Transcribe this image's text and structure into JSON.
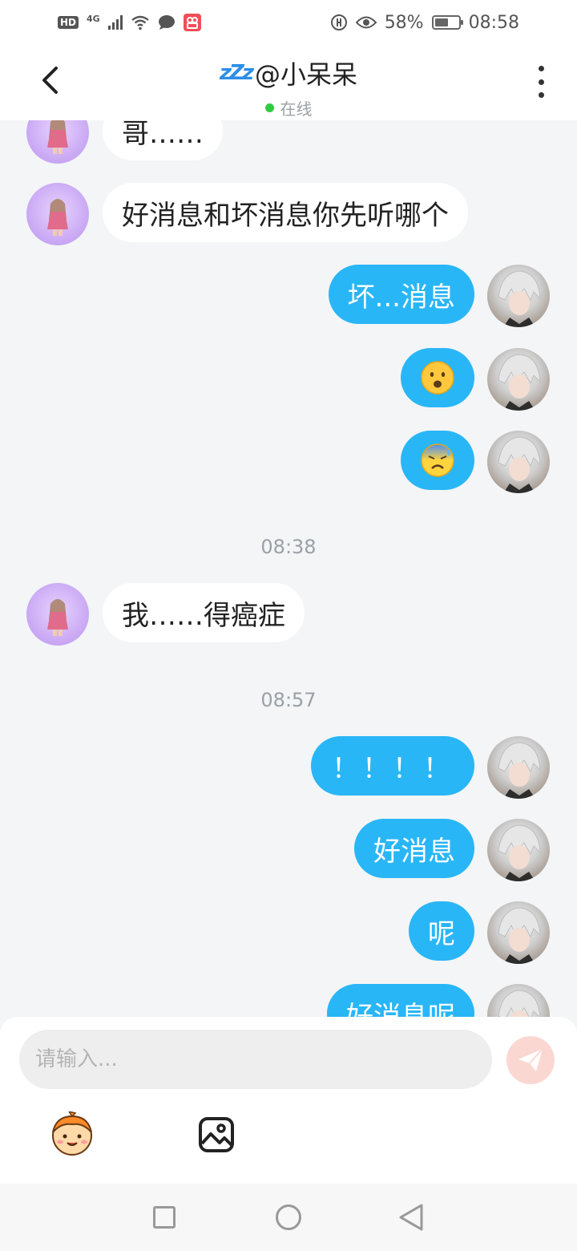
{
  "status_bar": {
    "hd": "HD",
    "network": "4G",
    "battery": "58%",
    "battery_level": 0.58,
    "time": "08:58"
  },
  "header": {
    "sleep_symbol": "zZz",
    "title": "@小呆呆",
    "status": "在线"
  },
  "messages": [
    {
      "side": "in",
      "text": "哥……"
    },
    {
      "side": "in",
      "text": "好消息和坏消息你先听哪个"
    },
    {
      "side": "out",
      "text": "坏...消息"
    },
    {
      "side": "out",
      "emoji": "astonished-face"
    },
    {
      "side": "out",
      "emoji": "anxious-sweat-face"
    },
    {
      "time": "08:38"
    },
    {
      "side": "in",
      "text": "我……得癌症"
    },
    {
      "time": "08:57"
    },
    {
      "side": "out",
      "text": "！！！！"
    },
    {
      "side": "out",
      "text": "好消息"
    },
    {
      "side": "out",
      "text": "呢"
    },
    {
      "side": "out",
      "text": "好消息呢"
    }
  ],
  "composer": {
    "placeholder": "请输入...",
    "send_icon": "send-icon",
    "sticker_icon": "sticker-icon",
    "image_icon": "image-icon"
  },
  "colors": {
    "outgoing_bubble": "#29b6f6",
    "incoming_bubble": "#ffffff",
    "online_dot": "#2ecc40",
    "send_button": "#fbd7d2",
    "chat_background": "#f3f5f7"
  }
}
